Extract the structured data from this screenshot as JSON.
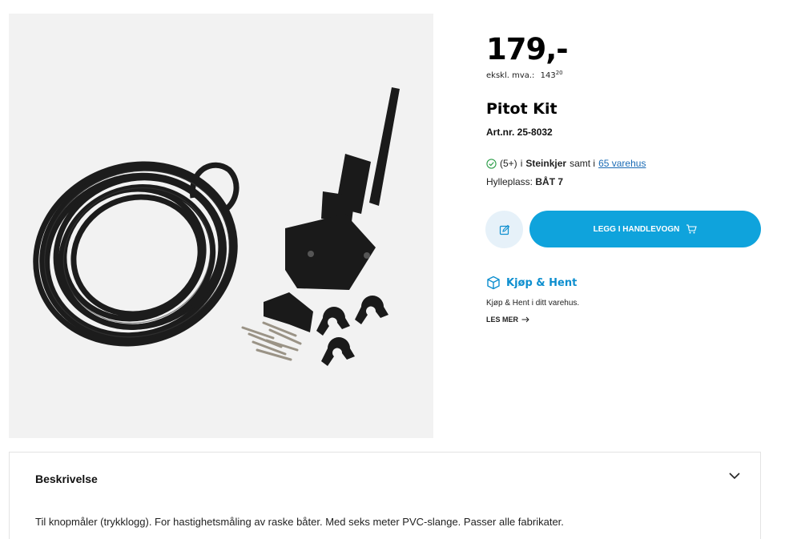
{
  "product": {
    "price": "179,-",
    "price_ex_vat_label": "ekskl. mva.:",
    "price_ex_vat_int": "143",
    "price_ex_vat_dec": "20",
    "title": "Pitot Kit",
    "art_nr": "Art.nr. 25-8032"
  },
  "stock": {
    "count": "(5+)",
    "in_word": "i",
    "store": "Steinkjer",
    "and_word": "samt i",
    "warehouses_link": "65 varehus",
    "shelf_label": "Hylleplass:",
    "shelf_value": "BÅT 7"
  },
  "actions": {
    "add_to_cart": "LEGG I HANDLEVOGN"
  },
  "pickup": {
    "title": "Kjøp & Hent",
    "text": "Kjøp & Hent i ditt varehus.",
    "read_more": "LES MER"
  },
  "description": {
    "header": "Beskrivelse",
    "text": "Til knopmåler (trykklogg). For hastighetsmåling av raske båter. Med seks meter PVC-slange. Passer alle fabrikater."
  },
  "colors": {
    "accent": "#0fa3dc",
    "link": "#1a6bb5",
    "stock_green": "#2e9e4a",
    "image_bg": "#f2f2f2"
  },
  "icons": [
    "check-icon",
    "edit-note-icon",
    "cart-icon",
    "box-icon",
    "arrow-right-icon",
    "chevron-down-icon"
  ]
}
